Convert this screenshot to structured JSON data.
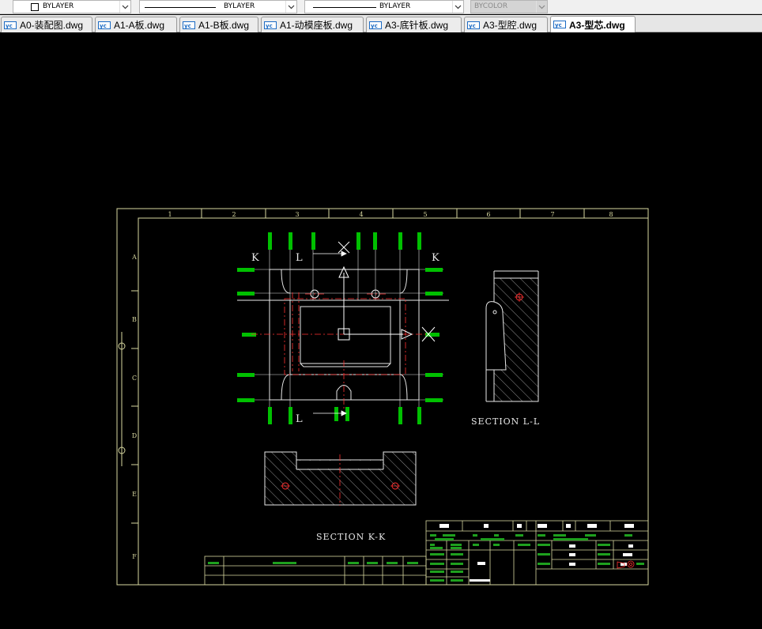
{
  "properties_bar": {
    "color_value": "BYLAYER",
    "linetype_value": "BYLAYER",
    "lineweight_value": "BYLAYER",
    "plotstyle_value": "BYCOLOR"
  },
  "tabs": [
    {
      "label": "A0-装配图.dwg"
    },
    {
      "label": "A1-A板.dwg"
    },
    {
      "label": "A1-B板.dwg"
    },
    {
      "label": "A1-动模座板.dwg"
    },
    {
      "label": "A3-底针板.dwg"
    },
    {
      "label": "A3-型腔.dwg"
    },
    {
      "label": "A3-型芯.dwg",
      "active": true
    }
  ],
  "drawing": {
    "col_labels": [
      "1",
      "2",
      "3",
      "4",
      "5",
      "6",
      "7",
      "8"
    ],
    "row_labels": [
      "A",
      "B",
      "C",
      "D",
      "E",
      "F"
    ],
    "section_kk_title": "SECTION K-K",
    "section_ll_title": "SECTION L-L",
    "cut_letter_k": "K",
    "cut_letter_l": "L"
  },
  "colors": {
    "background": "#000000",
    "frame": "#d8d8a0",
    "geometry": "#e8e8e8",
    "dimension": "#00c000",
    "centerline": "#ff3030",
    "title_text": "#ffffff"
  },
  "icons": [
    "dropdown-arrow-icon",
    "dwg-file-icon",
    "ucs-icon"
  ]
}
